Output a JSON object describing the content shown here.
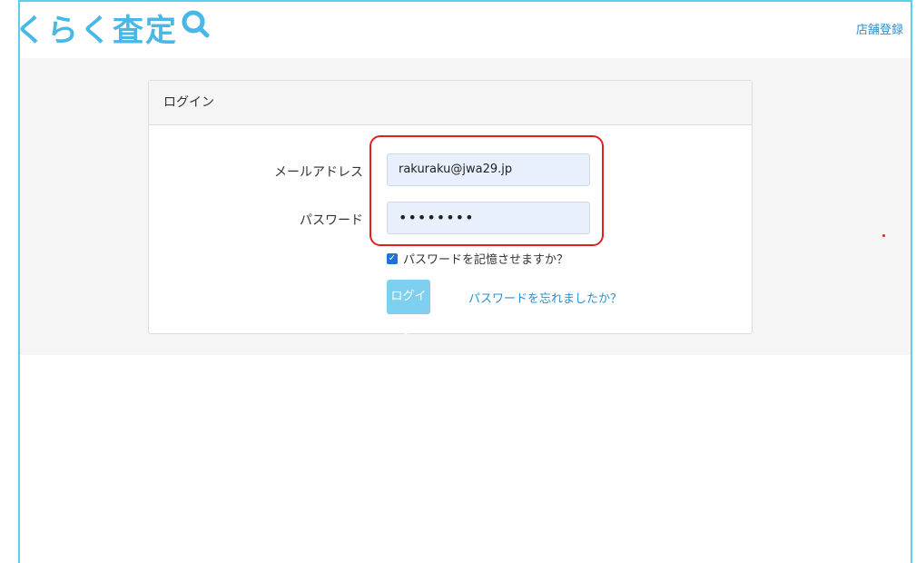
{
  "header": {
    "logo_text": "くらく査定",
    "logo_icon": "search-icon",
    "store_register_link": "店舗登録"
  },
  "login_card": {
    "title": "ログイン",
    "email_label": "メールアドレス",
    "email_value": "rakuraku@jwa29.jp",
    "password_label": "パスワード",
    "password_value": "••••••••",
    "remember_checked": true,
    "remember_label": "パスワードを記憶させますか？",
    "login_button": "ログイン",
    "forgot_link": "パスワードを忘れましたか？"
  },
  "colors": {
    "brand": "#4ab8e6",
    "link": "#2a8fcb",
    "button": "#7fd0f0",
    "annotation": "#e02020",
    "frame": "#5bd0ee"
  }
}
